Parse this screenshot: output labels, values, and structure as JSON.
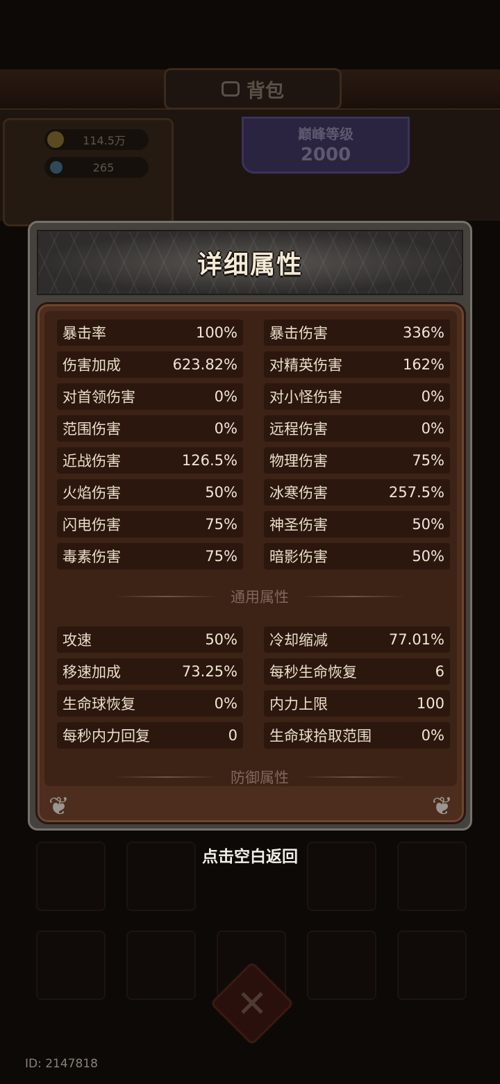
{
  "background": {
    "window_title": "背包",
    "currencies": [
      {
        "icon": "gold-coin-icon",
        "value": "114.5万"
      },
      {
        "icon": "gem-icon",
        "value": "265"
      }
    ],
    "peak_level": {
      "label": "巅峰等级",
      "value": "2000"
    },
    "user_id": "ID: 2147818"
  },
  "modal": {
    "title": "详细属性",
    "attack_stats": [
      {
        "label": "暴击率",
        "value": "100%"
      },
      {
        "label": "暴击伤害",
        "value": "336%"
      },
      {
        "label": "伤害加成",
        "value": "623.82%"
      },
      {
        "label": "对精英伤害",
        "value": "162%"
      },
      {
        "label": "对首领伤害",
        "value": "0%"
      },
      {
        "label": "对小怪伤害",
        "value": "0%"
      },
      {
        "label": "范围伤害",
        "value": "0%"
      },
      {
        "label": "远程伤害",
        "value": "0%"
      },
      {
        "label": "近战伤害",
        "value": "126.5%"
      },
      {
        "label": "物理伤害",
        "value": "75%"
      },
      {
        "label": "火焰伤害",
        "value": "50%"
      },
      {
        "label": "冰寒伤害",
        "value": "257.5%"
      },
      {
        "label": "闪电伤害",
        "value": "75%"
      },
      {
        "label": "神圣伤害",
        "value": "50%"
      },
      {
        "label": "毒素伤害",
        "value": "75%"
      },
      {
        "label": "暗影伤害",
        "value": "50%"
      }
    ],
    "general_section_title": "通用属性",
    "general_stats": [
      {
        "label": "攻速",
        "value": "50%"
      },
      {
        "label": "冷却缩减",
        "value": "77.01%"
      },
      {
        "label": "移速加成",
        "value": "73.25%"
      },
      {
        "label": "每秒生命恢复",
        "value": "6"
      },
      {
        "label": "生命球恢复",
        "value": "0%"
      },
      {
        "label": "内力上限",
        "value": "100"
      },
      {
        "label": "每秒内力回复",
        "value": "0"
      },
      {
        "label": "生命球拾取范围",
        "value": "0%"
      }
    ],
    "defense_section_title": "防御属性"
  },
  "back_hint": "点击空白返回",
  "colors": {
    "panel_brown": "#4d2d1d",
    "row_dark": "#2b170e",
    "frame_gray": "#45423e",
    "background": "#0d0906"
  }
}
